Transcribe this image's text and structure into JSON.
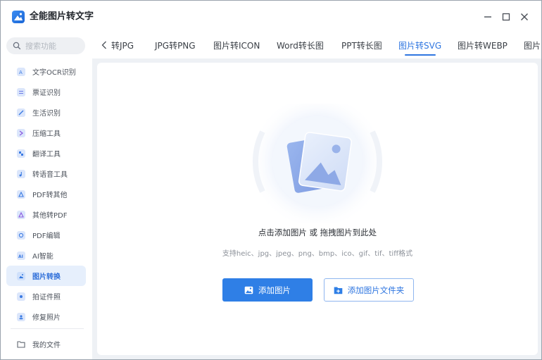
{
  "window": {
    "title": "全能图片转文字"
  },
  "sidebar": {
    "search_placeholder": "搜索功能",
    "items": [
      {
        "label": "文字OCR识别",
        "icon": "ocr-icon"
      },
      {
        "label": "票证识别",
        "icon": "ticket-icon"
      },
      {
        "label": "生活识别",
        "icon": "life-icon"
      },
      {
        "label": "压缩工具",
        "icon": "compress-icon"
      },
      {
        "label": "翻译工具",
        "icon": "translate-icon"
      },
      {
        "label": "转语音工具",
        "icon": "voice-icon"
      },
      {
        "label": "PDF转其他",
        "icon": "pdf-convert-icon"
      },
      {
        "label": "其他转PDF",
        "icon": "to-pdf-icon"
      },
      {
        "label": "PDF编辑",
        "icon": "pdf-edit-icon"
      },
      {
        "label": "AI智能",
        "icon": "ai-icon"
      },
      {
        "label": "图片转换",
        "icon": "image-convert-icon",
        "active": true
      },
      {
        "label": "拍证件照",
        "icon": "id-photo-icon"
      },
      {
        "label": "修复照片",
        "icon": "repair-photo-icon"
      }
    ],
    "my_files": "我的文件"
  },
  "tabs": [
    {
      "label": "转JPG"
    },
    {
      "label": "JPG转PNG"
    },
    {
      "label": "图片转ICON"
    },
    {
      "label": "Word转长图"
    },
    {
      "label": "PPT转长图"
    },
    {
      "label": "图片转SVG",
      "active": true
    },
    {
      "label": "图片转WEBP"
    },
    {
      "label": "图片"
    }
  ],
  "upload": {
    "title": "点击添加图片 或 拖拽图片到此处",
    "formats": "支持heic、jpg、jpeg、png、bmp、ico、gif、tif、tiff格式",
    "add_image_button": "添加图片",
    "add_folder_button": "添加图片文件夹"
  },
  "colors": {
    "accent": "#2f7fe6",
    "active_bg": "#e6effc",
    "content_bg": "#eef1f5"
  }
}
